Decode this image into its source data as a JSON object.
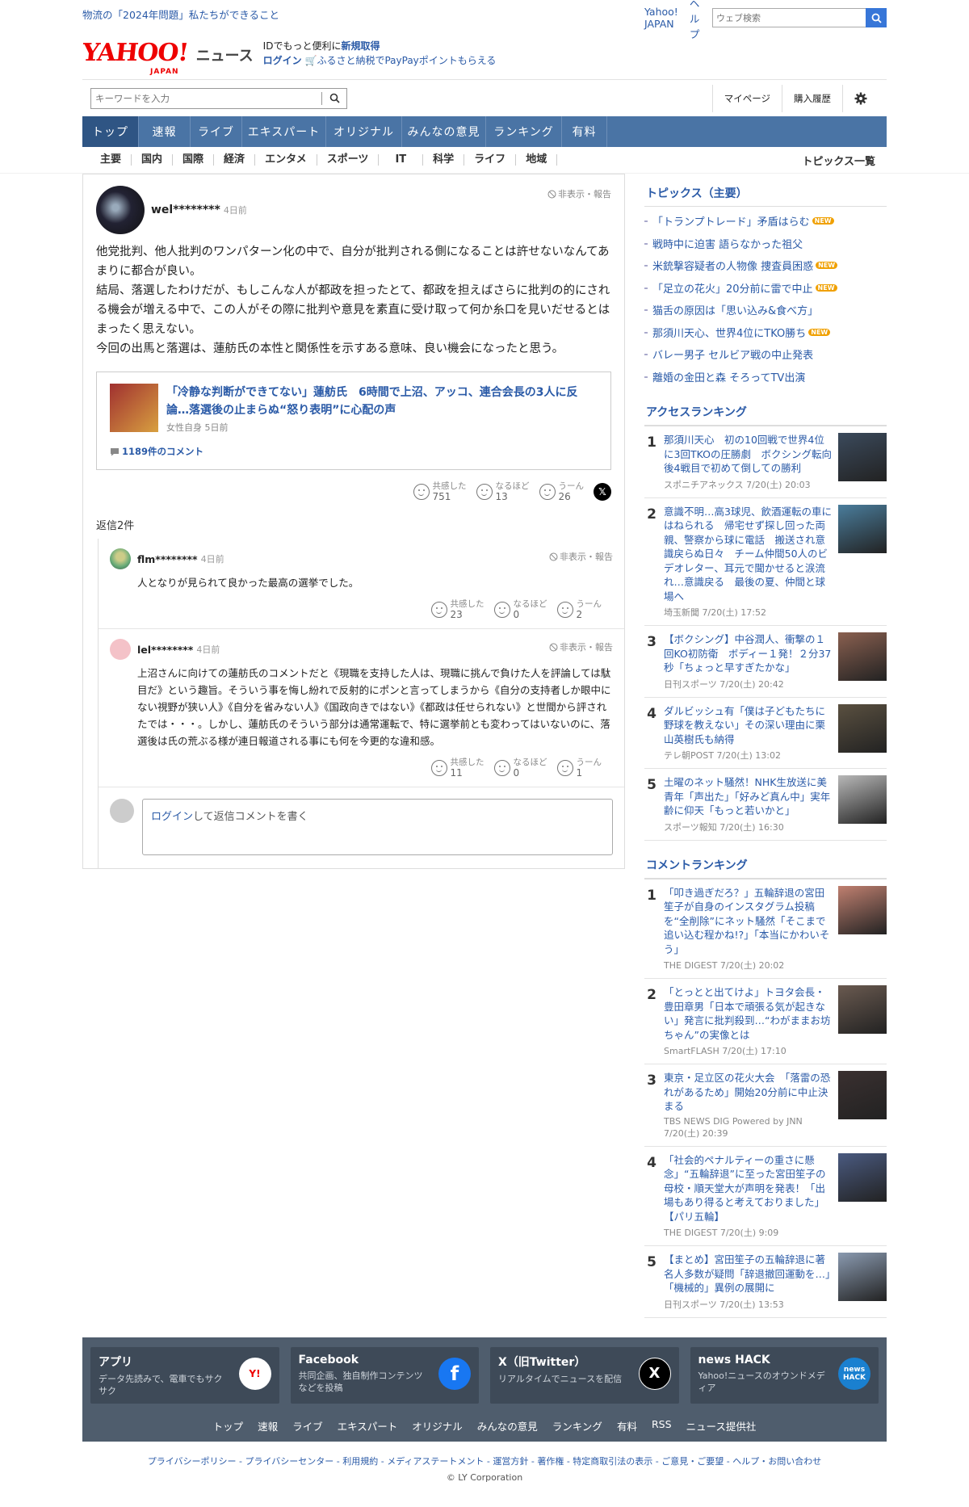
{
  "topbar": {
    "left_link": "物流の「2024年問題」私たちができること",
    "yahoo_japan": "Yahoo! JAPAN",
    "help": "ヘルプ",
    "web_search_placeholder": "ウェブ検索"
  },
  "logo": {
    "yahoo": "YAHOO!",
    "japan": "JAPAN",
    "news": "ニュース"
  },
  "promo": {
    "line1_prefix": "IDでもっと便利に",
    "line1_link": "新規取得",
    "login": "ログイン",
    "line2": "ふるさと納税でPayPayポイントもらえる"
  },
  "search": {
    "placeholder": "キーワードを入力",
    "mypage": "マイページ",
    "history": "購入履歴"
  },
  "nav": [
    "トップ",
    "速報",
    "ライブ",
    "エキスパート",
    "オリジナル",
    "みんなの意見",
    "ランキング",
    "有料"
  ],
  "subnav": [
    "主要",
    "国内",
    "国際",
    "経済",
    "エンタメ",
    "スポーツ",
    "IT",
    "科学",
    "ライフ",
    "地域"
  ],
  "subnav_more": "トピックス一覧",
  "comment": {
    "user": "wel********",
    "ago": "4日前",
    "report": "非表示・報告",
    "text": "他党批判、他人批判のワンパターン化の中で、自分が批判される側になることは許せないなんてあまりに都合が良い。\n結局、落選したわけだが、もしこんな人が都政を担ったとて、都政を担えばさらに批判の的にされる機会が増える中で、この人がその際に批判や意見を素直に受け取って何か糸口を見いだせるとはまったく思えない。\n今回の出馬と落選は、蓮舫氏の本性と関係性を示すある意味、良い機会になったと思う。",
    "article_title": "「冷静な判断ができてない」蓮舫氏　6時間で上沼、アッコ、連合会長の3人に反論…落選後の止まらぬ“怒り表明”に心配の声",
    "article_src": "女性自身 5日前",
    "article_comments": "1189件のコメント",
    "reactions": [
      {
        "label": "共感した",
        "count": "751"
      },
      {
        "label": "なるほど",
        "count": "13"
      },
      {
        "label": "うーん",
        "count": "26"
      }
    ]
  },
  "reply_count": "返信2件",
  "replies": [
    {
      "user": "flm********",
      "ago": "4日前",
      "report": "非表示・報告",
      "text": "人となりが見られて良かった最高の選挙でした。",
      "reactions": [
        {
          "label": "共感した",
          "count": "23"
        },
        {
          "label": "なるほど",
          "count": "0"
        },
        {
          "label": "うーん",
          "count": "2"
        }
      ]
    },
    {
      "user": "lel********",
      "ago": "4日前",
      "report": "非表示・報告",
      "text": "上沼さんに向けての蓮舫氏のコメントだと《現職を支持した人は、現職に挑んで負けた人を評論しては駄目だ》という趣旨。そういう事を悔し紛れで反射的にポンと言ってしまうから《自分の支持者しか眼中にない視野が狭い人》《自分を省みない人》《国政向きではない》《都政は任せられない》と世間から評されたでは・・・。しかし、蓮舫氏のそういう部分は通常運転で、特に選挙前とも変わってはいないのに、落選後は氏の荒ぶる様が連日報道される事にも何を今更的な違和感。",
      "reactions": [
        {
          "label": "共感した",
          "count": "11"
        },
        {
          "label": "なるほど",
          "count": "0"
        },
        {
          "label": "うーん",
          "count": "1"
        }
      ]
    }
  ],
  "reply_login": {
    "link": "ログイン",
    "rest": "して返信コメントを書く"
  },
  "topics": {
    "title": "トピックス（主要）",
    "items": [
      {
        "text": "「トランプトレード」矛盾はらむ",
        "new": "NEW"
      },
      {
        "text": "戦時中に迫害 語らなかった祖父",
        "new": ""
      },
      {
        "text": "米銃撃容疑者の人物像 捜査員困惑",
        "new": "NEW"
      },
      {
        "text": "「足立の花火」20分前に雷で中止",
        "new": "NEW"
      },
      {
        "text": "猫舌の原因は「思い込み&食べ方」",
        "new": ""
      },
      {
        "text": "那須川天心、世界4位にTKO勝ち",
        "new": "NEW"
      },
      {
        "text": "バレー男子 セルビア戦の中止発表",
        "new": ""
      },
      {
        "text": "離婚の金田と森 そろってTV出演",
        "new": ""
      }
    ]
  },
  "access_ranking": {
    "title": "アクセスランキング",
    "items": [
      {
        "n": "1",
        "t": "那須川天心　初の10回戦で世界4位に3回TKOの圧勝劇　ボクシング転向後4戦目で初めて倒しての勝利",
        "s": "スポニチアネックス 7/20(土) 20:03",
        "color": "#3b4a5c"
      },
      {
        "n": "2",
        "t": "意識不明…高3球児、飲酒運転の車にはねられる　帰宅せず探し回った両親、警察から球に電話　搬送され意識戻らぬ日々　チーム仲間50人のビデオレター、耳元で聞かせると涙流れ…意識戻る　最後の夏、仲間と球場へ",
        "s": "埼玉新聞 7/20(土) 17:52",
        "color": "#4a7d9c"
      },
      {
        "n": "3",
        "t": "【ボクシング】中谷潤人、衝撃の１回KO初防衛　ボディー１発！２分37秒「ちょっと早すぎたかな」",
        "s": "日刊スポーツ 7/20(土) 20:42",
        "color": "#8a6050"
      },
      {
        "n": "4",
        "t": "ダルビッシュ有「僕は子どもたちに野球を教えない」その深い理由に栗山英樹氏も納得",
        "s": "テレ朝POST 7/20(土) 13:02",
        "color": "#5a5040"
      },
      {
        "n": "5",
        "t": "土曜のネット騒然！NHK生放送に美青年「声出た」「好みど真ん中」実年齢に仰天「もっと若いかと」",
        "s": "スポーツ報知 7/20(土) 16:30",
        "color": "#b8b8b8"
      }
    ]
  },
  "comment_ranking": {
    "title": "コメントランキング",
    "items": [
      {
        "n": "1",
        "t": "「叩き過ぎだろ？」五輪辞退の宮田笙子が自身のインスタグラム投稿を“全削除”にネット騒然「そこまで追い込む程かね!?」「本当にかわいそう」",
        "s": "THE DIGEST 7/20(土) 20:02",
        "color": "#c08070"
      },
      {
        "n": "2",
        "t": "「とっとと出てけよ」トヨタ会長・豊田章男「日本で頑張る気が起きない」発言に批判殺到…“わがままお坊ちゃん”の実像とは",
        "s": "SmartFLASH 7/20(土) 17:10",
        "color": "#6a5a50"
      },
      {
        "n": "3",
        "t": "東京・足立区の花火大会　「落雷の恐れがあるため」開始20分前に中止決まる",
        "s": "TBS NEWS DIG Powered by JNN 7/20(土) 20:39",
        "color": "#3a3030"
      },
      {
        "n": "4",
        "t": "「社会的ペナルティーの重さに懸念」“五輪辞退”に至った宮田笙子の母校・順天堂大が声明を発表！「出場もあり得ると考えておりました」【パリ五輪】",
        "s": "THE DIGEST 7/20(土) 9:09",
        "color": "#4a5a80"
      },
      {
        "n": "5",
        "t": "【まとめ】宮田笙子の五輪辞退に著名人多数が疑問「辞退撤回運動を…」「機械的」異例の展開に",
        "s": "日刊スポーツ 7/20(土) 13:53",
        "color": "#8a9ab0"
      }
    ]
  },
  "footer": {
    "cards": [
      {
        "h": "アプリ",
        "d": "データ先読みで、電車でもサクサク",
        "icon": "Y!"
      },
      {
        "h": "Facebook",
        "d": "共同企画、独自制作コンテンツなどを投稿",
        "icon": "f"
      },
      {
        "h": "X（旧Twitter）",
        "d": "リアルタイムでニュースを配信",
        "icon": "X"
      },
      {
        "h": "news HACK",
        "d": "Yahoo!ニュースのオウンドメディア",
        "icon": "news HACK"
      }
    ],
    "links": [
      "トップ",
      "速報",
      "ライブ",
      "エキスパート",
      "オリジナル",
      "みんなの意見",
      "ランキング",
      "有料",
      "RSS",
      "ニュース提供社"
    ],
    "policy": "プライバシーポリシー - プライバシーセンター - 利用規約 - メディアステートメント - 運営方針 - 著作権 - 特定商取引法の表示 - ご意見・ご要望 - ヘルプ・お問い合わせ",
    "copyright": "© LY Corporation"
  }
}
